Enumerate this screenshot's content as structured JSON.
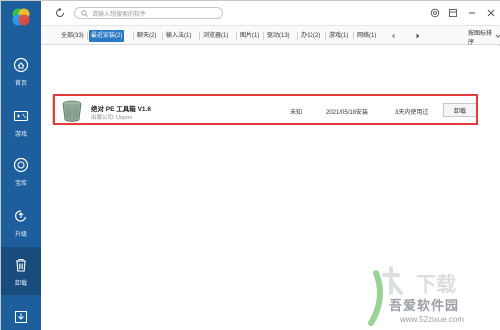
{
  "search": {
    "placeholder": "请输入想搜索的软件"
  },
  "sidebar": {
    "items": [
      {
        "label": "首页",
        "icon": "home-icon"
      },
      {
        "label": "游戏",
        "icon": "gamepad-icon"
      },
      {
        "label": "宝库",
        "icon": "treasure-icon"
      },
      {
        "label": "升级",
        "icon": "upgrade-icon"
      },
      {
        "label": "卸载",
        "icon": "trash-icon"
      }
    ],
    "bottom_icon": "download-icon",
    "colors": {
      "bg": "#1d5f9c",
      "active": "#174c7d"
    }
  },
  "tabs": [
    {
      "label": "全部(33)"
    },
    {
      "label": "最近安装(2)"
    },
    {
      "label": "聊天(2)"
    },
    {
      "label": "输入法(1)"
    },
    {
      "label": "浏览器(1)"
    },
    {
      "label": "图片(1)"
    },
    {
      "label": "驱动(13)"
    },
    {
      "label": "办公(2)"
    },
    {
      "label": "游戏(1)"
    },
    {
      "label": "网络(1)"
    }
  ],
  "sort_label": "按图标排序",
  "rows": [
    {
      "name": "绝对 PE 工具箱 V1.6",
      "publisher": "出版公司: Uepon",
      "size": "未知",
      "date": "2021/05/18安装",
      "usage": "3天内使用过",
      "action": "卸载"
    }
  ],
  "watermark": {
    "text": "吾爱软件园",
    "url": "www.52zixue.com",
    "logo_text": "下载"
  }
}
